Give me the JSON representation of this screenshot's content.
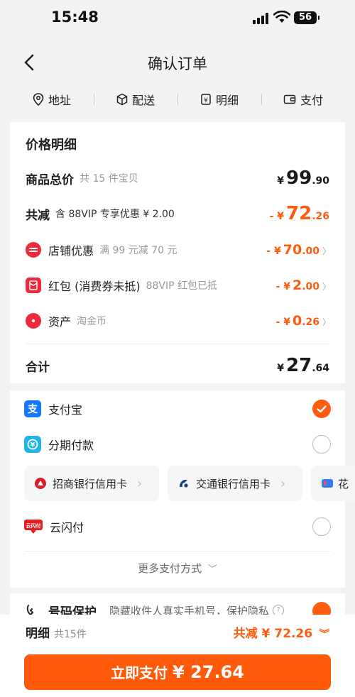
{
  "status": {
    "time": "15:48",
    "battery": "56"
  },
  "nav": {
    "title": "确认订单"
  },
  "tabs": [
    {
      "label": "地址",
      "icon": "location-pin-icon"
    },
    {
      "label": "配送",
      "icon": "package-icon"
    },
    {
      "label": "明细",
      "icon": "receipt-icon"
    },
    {
      "label": "支付",
      "icon": "wallet-icon"
    }
  ],
  "price": {
    "title": "价格明细",
    "total": {
      "label": "商品总价",
      "sub": "共 15 件宝贝",
      "currency": "¥",
      "int": "99",
      "dec": ".90"
    },
    "reduce": {
      "label": "共减",
      "sub": "含 88VIP 专享优惠 ¥ 2.00",
      "prefix": "- ¥",
      "int": "72",
      "dec": ".26"
    },
    "store": {
      "label": "店铺优惠",
      "sub": "满 99 元减 70 元",
      "prefix": "- ¥",
      "int": "70",
      "dec": ".00"
    },
    "redpack": {
      "label": "红包 (消费券未抵)",
      "sub": "88VIP 红包已抵",
      "prefix": "- ¥",
      "int": "2",
      "dec": ".00"
    },
    "asset": {
      "label": "资产",
      "sub": "淘金币",
      "prefix": "- ¥",
      "int": "0",
      "dec": ".26"
    },
    "sum": {
      "label": "合计",
      "currency": "¥",
      "int": "27",
      "dec": ".64"
    }
  },
  "pay": {
    "alipay": "支付宝",
    "installment": "分期付款",
    "banks": [
      "招商银行信用卡",
      "交通银行信用卡",
      "花"
    ],
    "unionpay": "云闪付",
    "unionpay_badge": "云闪付",
    "more": "更多支付方式"
  },
  "privacy": {
    "label": "号码保护",
    "text": "隐藏收件人真实手机号，保护隐私"
  },
  "bottom": {
    "detail": "明细",
    "count": "共15件",
    "reduce": "共减 ¥ 72.26",
    "button_label": "立即支付",
    "button_amount": "¥ 27.64"
  },
  "colors": {
    "accent": "#ff5b0f",
    "alipay": "#1677ff"
  }
}
